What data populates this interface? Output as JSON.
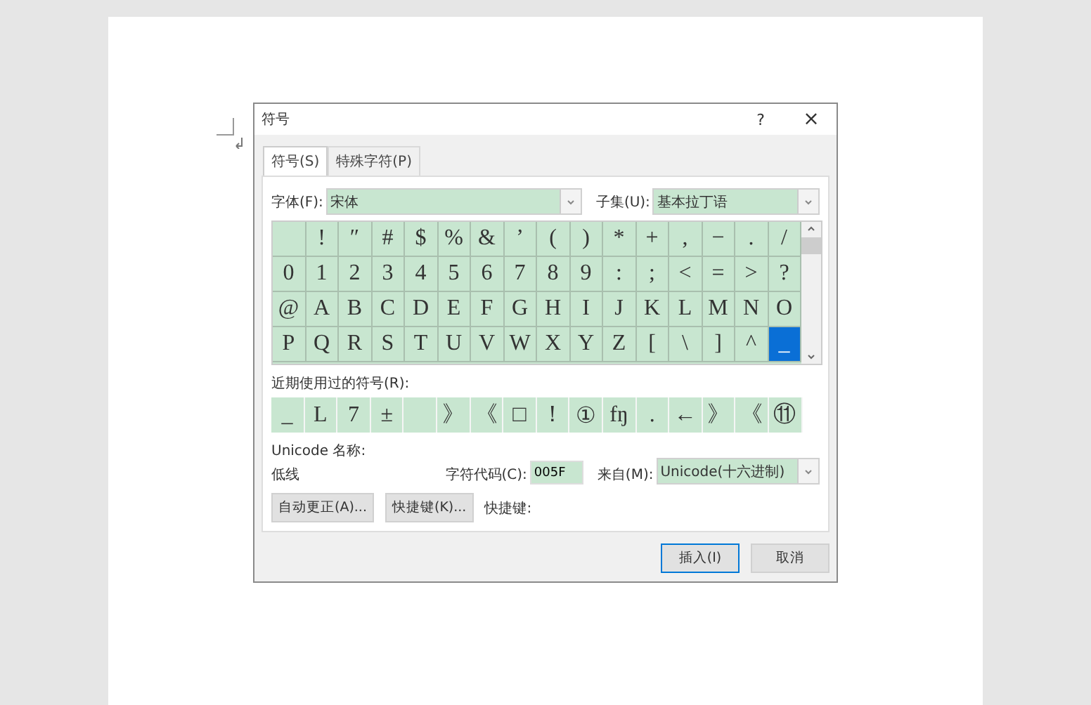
{
  "window": {
    "title": "符号",
    "help": "?",
    "close": "×"
  },
  "tabs": [
    {
      "label": "符号(S)",
      "selected": true
    },
    {
      "label": "特殊字符(P)",
      "selected": false
    }
  ],
  "font": {
    "label": "字体(F):",
    "value": "宋体"
  },
  "subset": {
    "label": "子集(U):",
    "value": "基本拉丁语"
  },
  "grid": [
    [
      {
        "selected": false
      },
      {
        "c": "!",
        "selected": false
      },
      {
        "c": "″",
        "selected": false
      },
      {
        "c": "#",
        "selected": false
      },
      {
        "c": "$",
        "selected": false
      },
      {
        "c": "%",
        "selected": false
      },
      {
        "c": "&",
        "selected": false
      },
      {
        "c": "’",
        "selected": false
      },
      {
        "c": "(",
        "selected": false
      },
      {
        "c": ")",
        "selected": false
      },
      {
        "c": "*",
        "selected": false
      },
      {
        "c": "+",
        "selected": false
      },
      {
        "c": ",",
        "selected": false
      },
      {
        "c": "−",
        "selected": false
      },
      {
        "c": ".",
        "selected": false
      },
      {
        "c": "/",
        "selected": false
      }
    ],
    [
      {
        "c": "0",
        "selected": false
      },
      {
        "c": "1",
        "selected": false
      },
      {
        "c": "2",
        "selected": false
      },
      {
        "c": "3",
        "selected": false
      },
      {
        "c": "4",
        "selected": false
      },
      {
        "c": "5",
        "selected": false
      },
      {
        "c": "6",
        "selected": false
      },
      {
        "c": "7",
        "selected": false
      },
      {
        "c": "8",
        "selected": false
      },
      {
        "c": "9",
        "selected": false
      },
      {
        "c": ":",
        "selected": false
      },
      {
        "c": ";",
        "selected": false
      },
      {
        "c": "<",
        "selected": false
      },
      {
        "c": "=",
        "selected": false
      },
      {
        "c": ">",
        "selected": false
      },
      {
        "c": "?",
        "selected": false
      }
    ],
    [
      {
        "c": "@",
        "selected": false
      },
      {
        "c": "A",
        "selected": false
      },
      {
        "c": "B",
        "selected": false
      },
      {
        "c": "C",
        "selected": false
      },
      {
        "c": "D",
        "selected": false
      },
      {
        "c": "E",
        "selected": false
      },
      {
        "c": "F",
        "selected": false
      },
      {
        "c": "G",
        "selected": false
      },
      {
        "c": "H",
        "selected": false
      },
      {
        "c": "I",
        "selected": false
      },
      {
        "c": "J",
        "selected": false
      },
      {
        "c": "K",
        "selected": false
      },
      {
        "c": "L",
        "selected": false
      },
      {
        "c": "M",
        "selected": false
      },
      {
        "c": "N",
        "selected": false
      },
      {
        "c": "O",
        "selected": false
      }
    ],
    [
      {
        "c": "P",
        "selected": false
      },
      {
        "c": "Q",
        "selected": false
      },
      {
        "c": "R",
        "selected": false
      },
      {
        "c": "S",
        "selected": false
      },
      {
        "c": "T",
        "selected": false
      },
      {
        "c": "U",
        "selected": false
      },
      {
        "c": "V",
        "selected": false
      },
      {
        "c": "W",
        "selected": false
      },
      {
        "c": "X",
        "selected": false
      },
      {
        "c": "Y",
        "selected": false
      },
      {
        "c": "Z",
        "selected": false
      },
      {
        "c": "[",
        "selected": false
      },
      {
        "c": "\\",
        "selected": false
      },
      {
        "c": "]",
        "selected": false
      },
      {
        "c": "^",
        "selected": false
      },
      {
        "c": "_",
        "selected": true
      }
    ]
  ],
  "recent_label": "近期使用过的符号(R):",
  "recent": [
    {
      "kind": "symbol",
      "c": "_"
    },
    {
      "kind": "symbol",
      "c": "L"
    },
    {
      "kind": "symbol",
      "c": "7"
    },
    {
      "kind": "symbol",
      "c": "±"
    },
    {
      "kind": "empty"
    },
    {
      "kind": "symbol",
      "c": "》"
    },
    {
      "kind": "symbol",
      "c": "《"
    },
    {
      "kind": "symbol",
      "c": "□"
    },
    {
      "kind": "symbol",
      "c": "！"
    },
    {
      "kind": "symbol",
      "c": "①"
    },
    {
      "kind": "symbol",
      "c": "fŋ"
    },
    {
      "kind": "symbol",
      "c": "."
    },
    {
      "kind": "symbol",
      "c": "←"
    },
    {
      "kind": "symbol",
      "c": "》"
    },
    {
      "kind": "symbol",
      "c": "《"
    },
    {
      "kind": "symbol",
      "c": "⑪"
    }
  ],
  "unicode_name_label": "Unicode 名称:",
  "unicode_name": "低线",
  "char_code": {
    "label": "字符代码(C):",
    "value": "005F"
  },
  "from": {
    "label": "来自(M):",
    "value": "Unicode(十六进制)"
  },
  "buttons": [
    {
      "label": "自动更正(A)..."
    },
    {
      "label": "快捷键(K)..."
    }
  ],
  "shortcut_label": "快捷键:",
  "footer_buttons": [
    {
      "label": "插入(I)",
      "kind": "default"
    },
    {
      "label": "取消",
      "kind": "normal"
    }
  ]
}
